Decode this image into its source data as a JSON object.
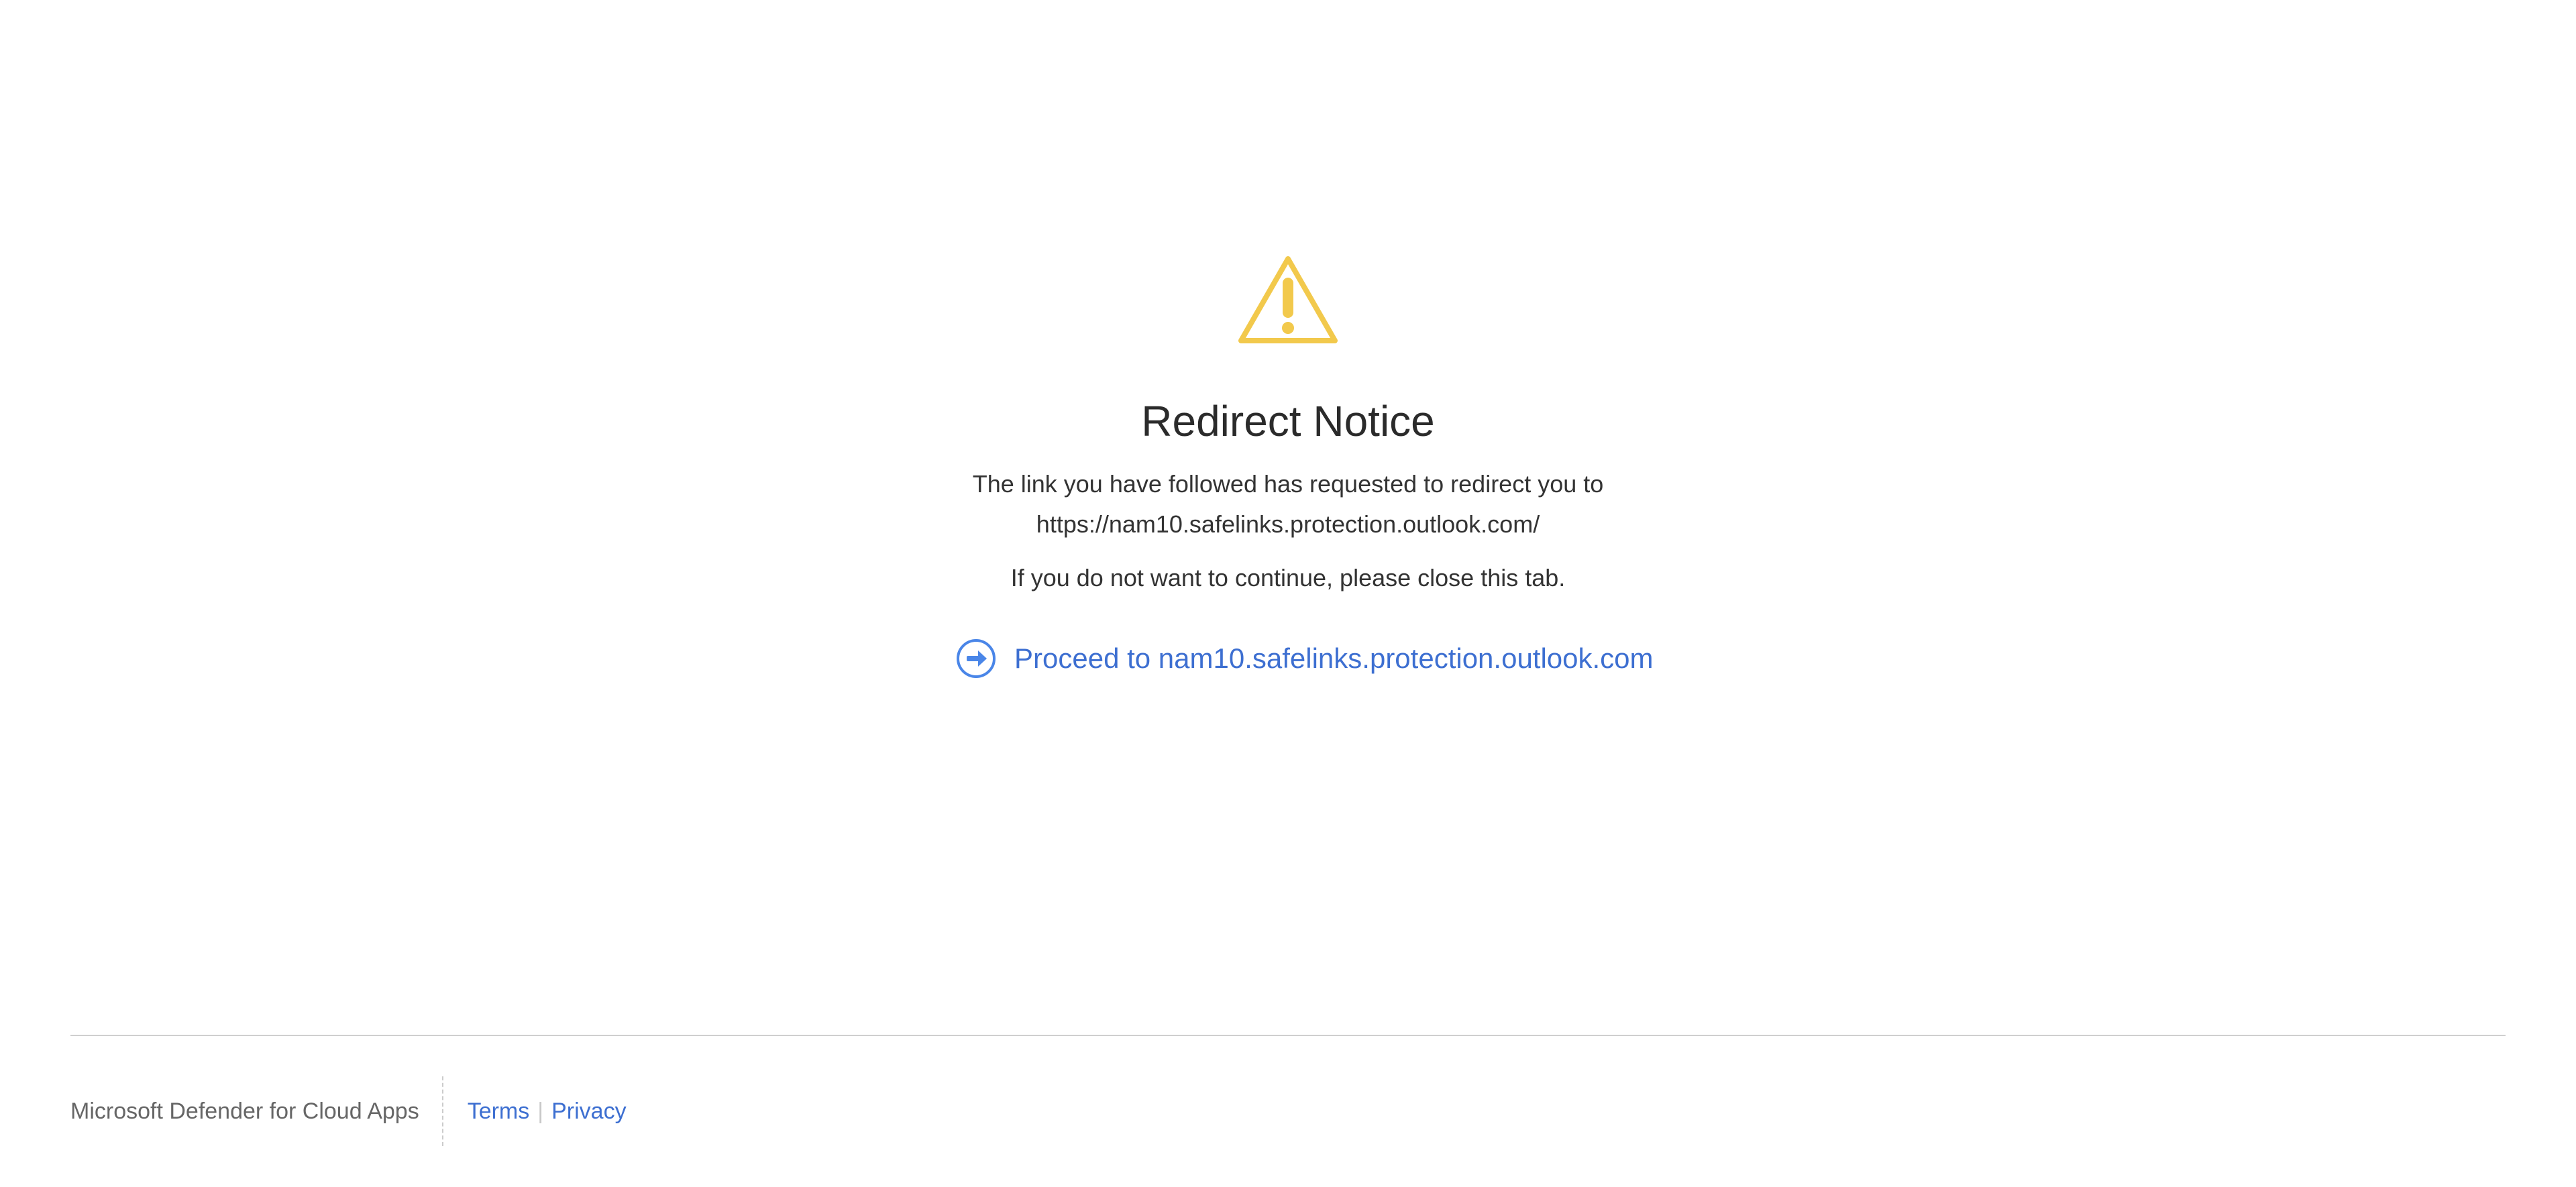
{
  "notice": {
    "icon": "warning-icon",
    "icon_color": "#f2c94c",
    "title": "Redirect Notice",
    "message_line_1": "The link you have followed has requested to redirect you to",
    "message_line_2": "https://nam10.safelinks.protection.outlook.com/",
    "close_message": "If you do not want to continue, please close this tab.",
    "proceed": {
      "icon": "arrow-right-circle-icon",
      "label": "Proceed to nam10.safelinks.protection.outlook.com",
      "color": "#3d6fd1"
    }
  },
  "footer": {
    "brand": "Microsoft Defender for Cloud Apps",
    "links": {
      "terms": "Terms",
      "separator": "|",
      "privacy": "Privacy"
    },
    "link_color": "#3d6fd1"
  }
}
